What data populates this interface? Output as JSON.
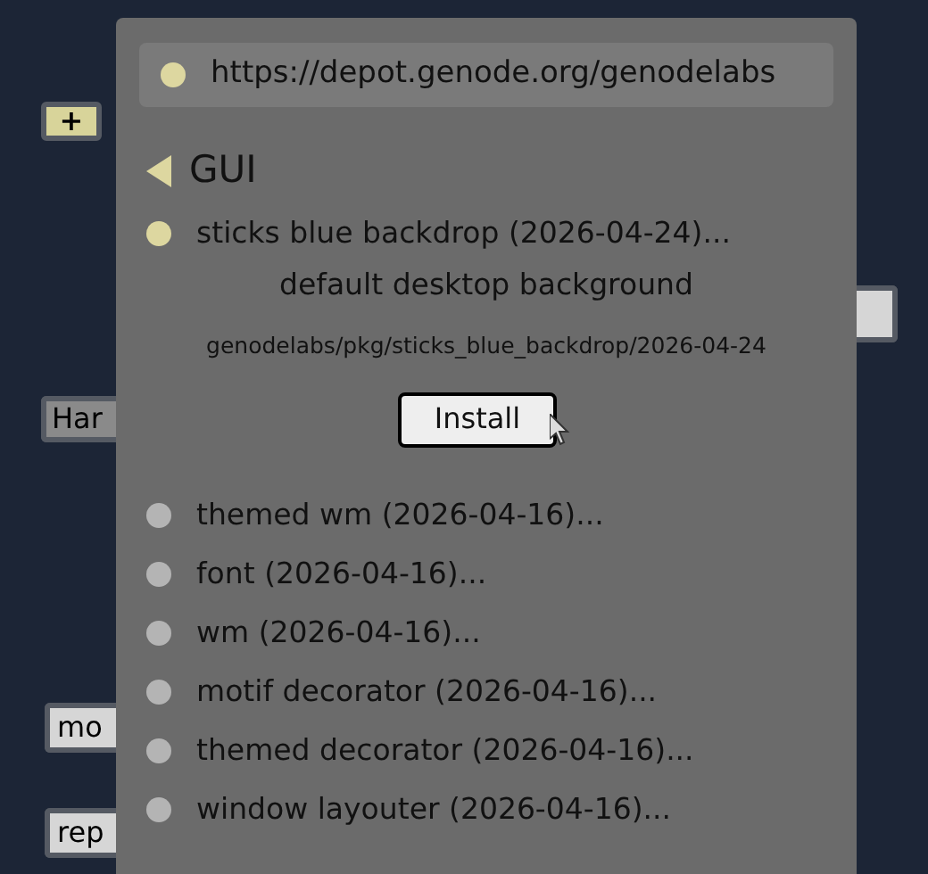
{
  "graph_nodes": [
    {
      "label": "+",
      "kind": "add"
    },
    {
      "label": "Har",
      "kind": "category"
    },
    {
      "kind": "component"
    },
    {
      "label": "mo",
      "kind": "component"
    },
    {
      "label": "rep",
      "kind": "component"
    }
  ],
  "popup": {
    "depot": {
      "url": "https://depot.genode.org/genodelabs",
      "selected": true
    },
    "category": {
      "label": "GUI"
    },
    "selected_package": {
      "name": "sticks blue backdrop (2026-04-24)...",
      "selected": true,
      "description": "default desktop background",
      "path": "genodelabs/pkg/sticks_blue_backdrop/2026-04-24",
      "button": "Install"
    },
    "packages": [
      {
        "name": "themed wm (2026-04-16)...",
        "selected": false
      },
      {
        "name": "font (2026-04-16)...",
        "selected": false
      },
      {
        "name": "wm (2026-04-16)...",
        "selected": false
      },
      {
        "name": "motif decorator (2026-04-16)...",
        "selected": false
      },
      {
        "name": "themed decorator (2026-04-16)...",
        "selected": false
      },
      {
        "name": "window layouter (2026-04-16)...",
        "selected": false
      }
    ]
  }
}
